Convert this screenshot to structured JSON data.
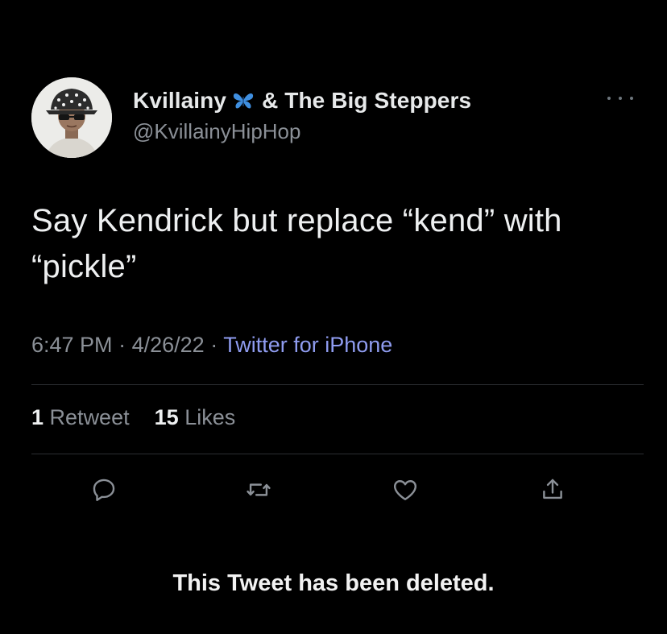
{
  "tweet": {
    "author": {
      "name_part1": "Kvillainy",
      "name_part2": "& The Big Steppers",
      "handle": "@KvillainyHipHop",
      "avatar_icon": "avatar-bucket-hat-photo",
      "name_emoji_icon": "butterfly-icon"
    },
    "text": "Say Kendrick but replace “kend” with “pickle”",
    "meta": {
      "time": "6:47 PM",
      "separator": "·",
      "date": "4/26/22",
      "source": "Twitter for iPhone"
    },
    "stats": {
      "retweet_count": "1",
      "retweet_label": "Retweet",
      "like_count": "15",
      "like_label": "Likes"
    },
    "actions": [
      {
        "name": "reply",
        "icon": "reply-icon"
      },
      {
        "name": "retweet",
        "icon": "retweet-icon"
      },
      {
        "name": "like",
        "icon": "heart-icon"
      },
      {
        "name": "share",
        "icon": "share-icon"
      }
    ],
    "more_icon": "more-icon"
  },
  "overlay": {
    "deleted_notice": "This Tweet has been deleted."
  },
  "colors": {
    "background": "#000000",
    "primary_text": "#e7e9ea",
    "secondary_text": "#8b9097",
    "source_link": "#8f9cf0",
    "divider": "#2b2e31",
    "butterfly": "#3f8fe0"
  }
}
